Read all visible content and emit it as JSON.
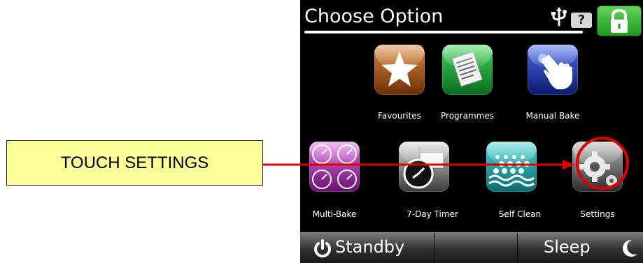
{
  "header": {
    "title": "Choose Option",
    "help_label": "?"
  },
  "tiles": [
    {
      "label": "Favourites",
      "color_top": "#e0893a",
      "color_bottom": "#6a2e06"
    },
    {
      "label": "Programmes",
      "color_top": "#3ed85a",
      "color_bottom": "#0c6a1e"
    },
    {
      "label": "Manual Bake",
      "color_top": "#4a6aee",
      "color_bottom": "#0c1a6a"
    },
    {
      "label": "Multi-Bake",
      "color_top": "#e06ae6",
      "color_bottom": "#6a106e"
    },
    {
      "label": "7-Day Timer",
      "color_top": "#d8d8d8",
      "color_bottom": "#3a3a3a"
    },
    {
      "label": "Self Clean",
      "color_top": "#46d6d2",
      "color_bottom": "#0a6a6e"
    },
    {
      "label": "Settings",
      "color_top": "#b8b8b8",
      "color_bottom": "#2a2a2a"
    }
  ],
  "bottom_bar": {
    "standby_label": "Standby",
    "sleep_label": "Sleep"
  },
  "callout": {
    "text": "TOUCH SETTINGS"
  },
  "colors": {
    "arrow": "#e00000",
    "lock_green": "#2aa82a",
    "callout_fill": "#fdfd9a"
  }
}
